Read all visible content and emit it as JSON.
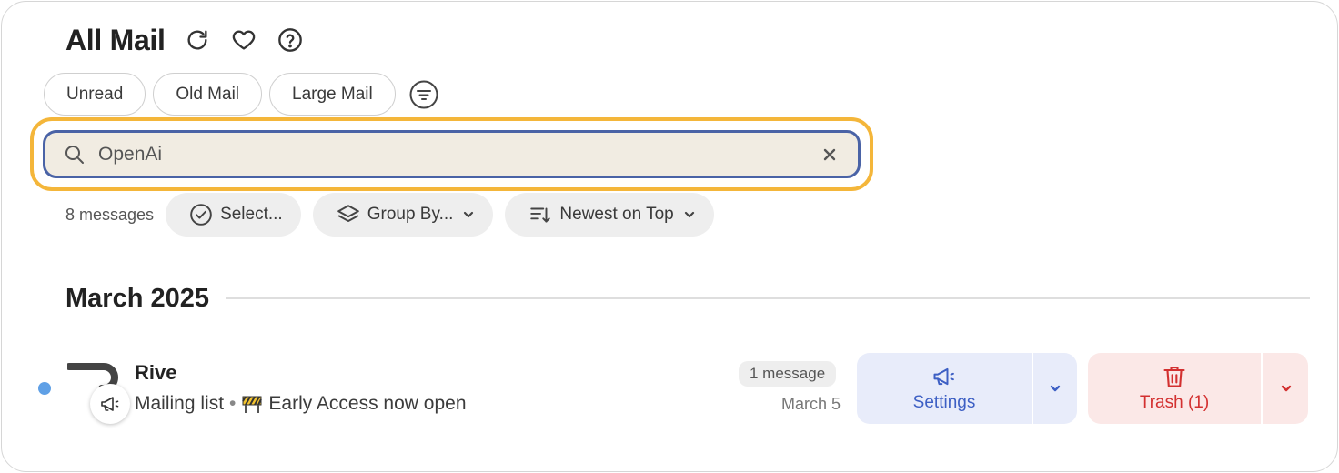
{
  "header": {
    "title": "All Mail"
  },
  "filters": [
    "Unread",
    "Old Mail",
    "Large Mail"
  ],
  "search": {
    "value": "OpenAi"
  },
  "toolbar": {
    "count": "8 messages",
    "select_label": "Select...",
    "group_label": "Group By...",
    "sort_label": "Newest on Top"
  },
  "section": {
    "title": "March 2025"
  },
  "email": {
    "sender": "Rive",
    "category": "Mailing list",
    "separator": "•",
    "subject": "Early Access now open",
    "message_count": "1 message",
    "date": "March 5",
    "actions": {
      "primary": "Settings",
      "secondary": "Trash (1)"
    }
  },
  "colors": {
    "search_highlight": "#f4b63a",
    "search_border": "#4a63a6",
    "unread_dot": "#5fa0e6",
    "settings_accent": "#3d5fc4",
    "trash_accent": "#d33030"
  }
}
